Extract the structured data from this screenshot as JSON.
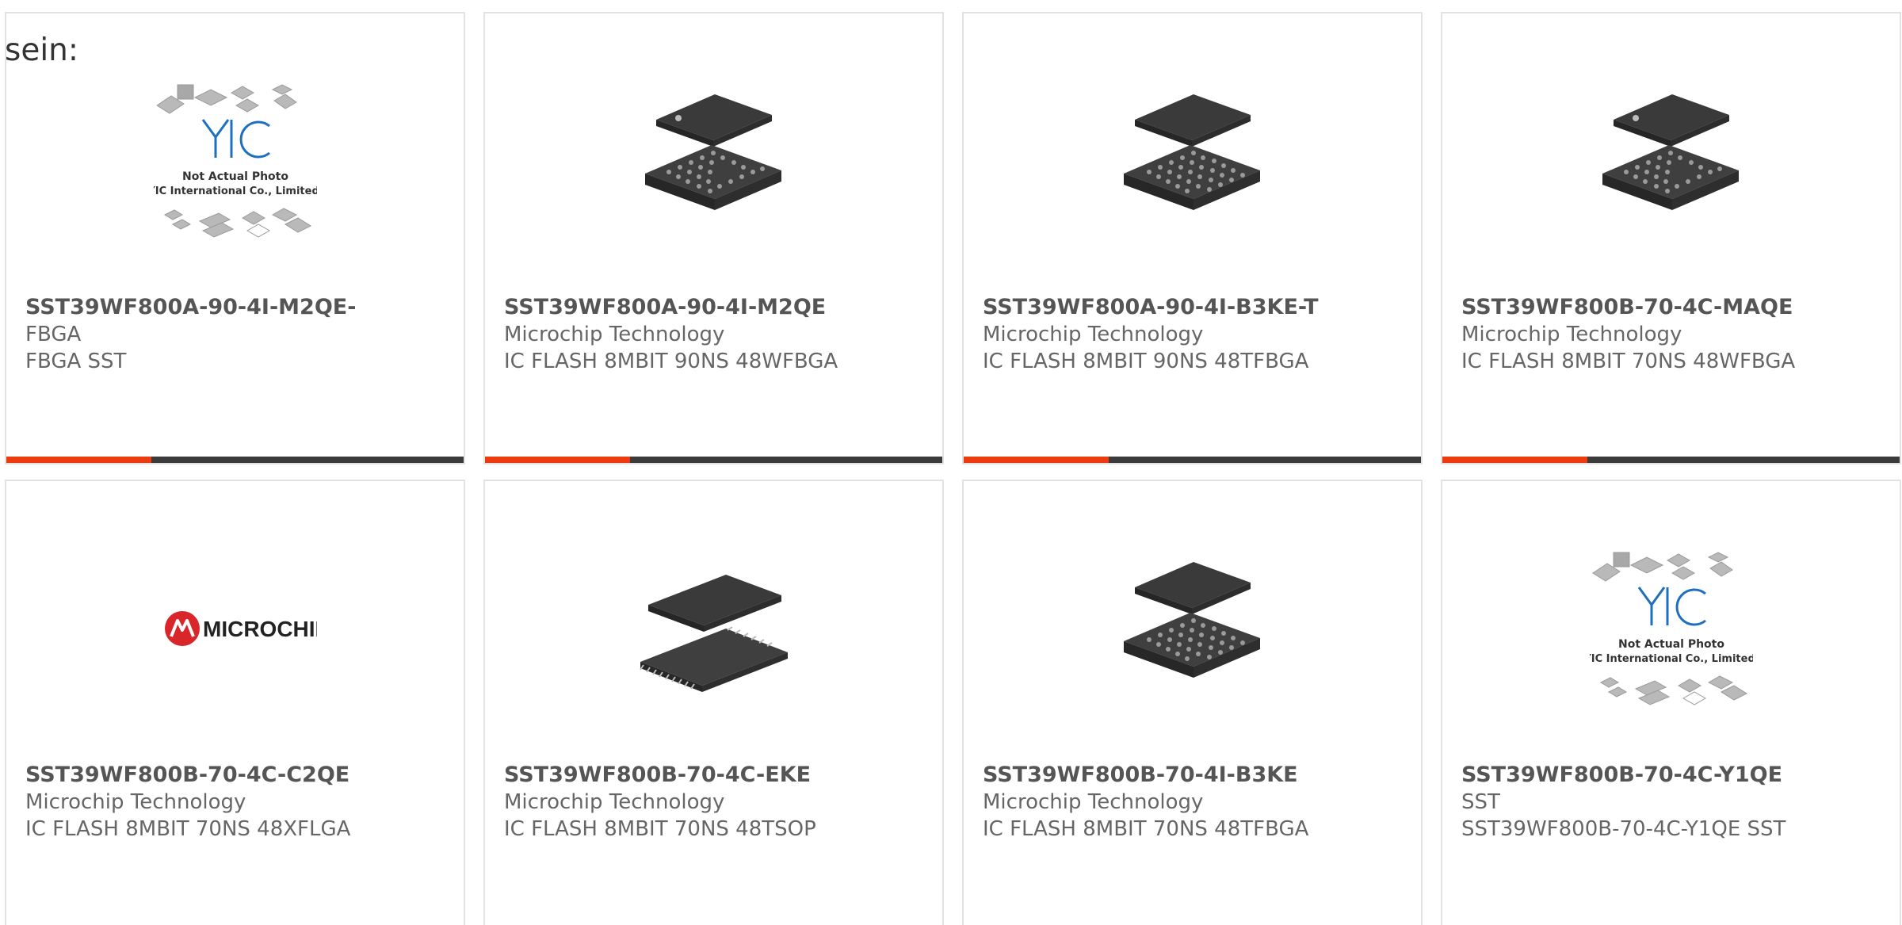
{
  "intro_text": "sein:",
  "colors": {
    "accent": "#ec3b0f",
    "bar": "#3b3b3b",
    "brand_red": "#d8262a",
    "yic_blue": "#1f6fc0"
  },
  "products": [
    {
      "part_number": "SST39WF800A-90-4I-M2QE-",
      "manufacturer": "FBGA",
      "description": "FBGA SST",
      "image": "yic-placeholder-icon",
      "placeholder_line1": "Not Actual Photo",
      "placeholder_line2": "YIC International Co., Limited."
    },
    {
      "part_number": "SST39WF800A-90-4I-M2QE",
      "manufacturer": "Microchip Technology",
      "description": "IC FLASH 8MBIT 90NS 48WFBGA",
      "image": "bga-chip-icon"
    },
    {
      "part_number": "SST39WF800A-90-4I-B3KE-T",
      "manufacturer": "Microchip Technology",
      "description": "IC FLASH 8MBIT 90NS 48TFBGA",
      "image": "bga-chip-icon"
    },
    {
      "part_number": "SST39WF800B-70-4C-MAQE",
      "manufacturer": "Microchip Technology",
      "description": "IC FLASH 8MBIT 70NS 48WFBGA",
      "image": "bga-chip-icon"
    },
    {
      "part_number": "SST39WF800B-70-4C-C2QE",
      "manufacturer": "Microchip Technology",
      "description": "IC FLASH 8MBIT 70NS 48XFLGA",
      "image": "microchip-logo",
      "logo_text": "MICROCHIP"
    },
    {
      "part_number": "SST39WF800B-70-4C-EKE",
      "manufacturer": "Microchip Technology",
      "description": "IC FLASH 8MBIT 70NS 48TSOP",
      "image": "tsop-chip-icon"
    },
    {
      "part_number": "SST39WF800B-70-4I-B3KE",
      "manufacturer": "Microchip Technology",
      "description": "IC FLASH 8MBIT 70NS 48TFBGA",
      "image": "bga-chip-icon"
    },
    {
      "part_number": "SST39WF800B-70-4C-Y1QE",
      "manufacturer": "SST",
      "description": "SST39WF800B-70-4C-Y1QE SST",
      "image": "yic-placeholder-icon",
      "placeholder_line1": "Not Actual Photo",
      "placeholder_line2": "YIC International Co., Limited."
    }
  ]
}
